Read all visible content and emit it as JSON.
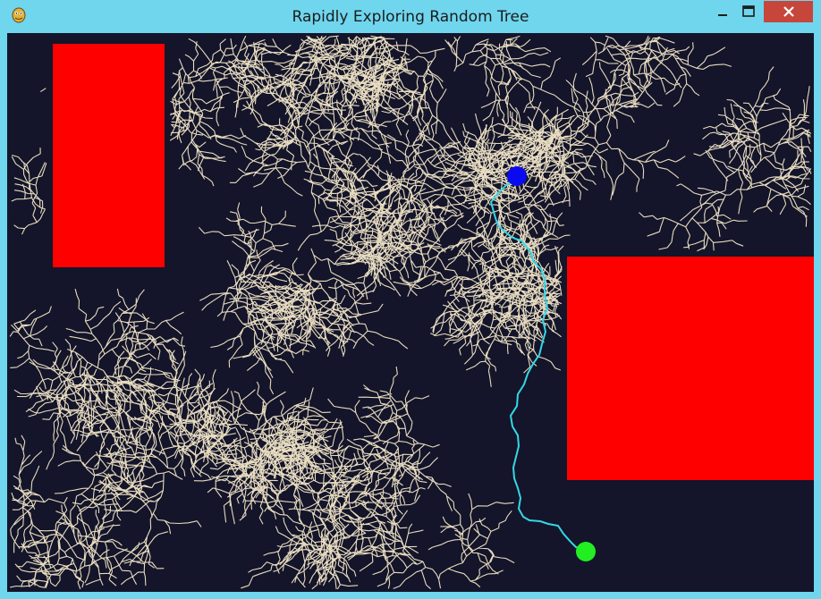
{
  "window": {
    "title": "Rapidly Exploring Random Tree",
    "icon": "pygame-snake-icon",
    "controls": [
      "minimize",
      "maximize",
      "close"
    ]
  },
  "colors": {
    "titlebar": "#6fd6ee",
    "canvas": "#14152a",
    "obstacle": "#ff0000",
    "tree": "#e8dcc0",
    "path": "#35d7e6",
    "start": "#22ee22",
    "goal": "#0a0af0",
    "close_button": "#c7463b"
  }
}
